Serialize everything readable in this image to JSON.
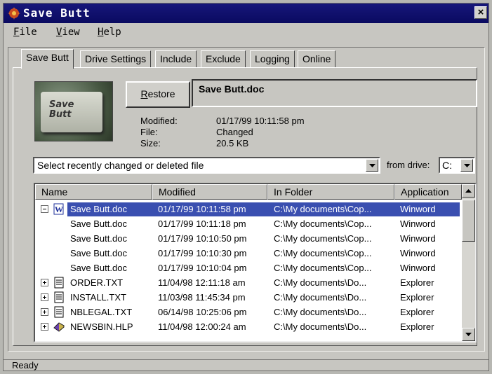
{
  "window": {
    "title": "Save Butt",
    "close_label": "×"
  },
  "menu": [
    {
      "key": "F",
      "rest": "ile"
    },
    {
      "key": "V",
      "rest": "iew"
    },
    {
      "key": "H",
      "rest": "elp"
    }
  ],
  "tabs": [
    "Save Butt",
    "Drive Settings",
    "Include",
    "Exclude",
    "Logging",
    "Online"
  ],
  "active_tab": "Save Butt",
  "logo": {
    "text": "Save\nButt"
  },
  "restore": {
    "key": "R",
    "rest": "estore"
  },
  "selected_file": {
    "name": "Save Butt.doc",
    "details": [
      {
        "label": "Modified:",
        "value": "01/17/99 10:11:58 pm"
      },
      {
        "label": "File:",
        "value": "Changed"
      },
      {
        "label": "Size:",
        "value": "20.5 KB"
      }
    ]
  },
  "file_select": {
    "value": "Select recently changed or deleted file"
  },
  "drive": {
    "label": "from drive:",
    "value": "C:"
  },
  "columns": [
    "Name",
    "Modified",
    "In Folder",
    "Application"
  ],
  "rows": [
    {
      "expander": "minus",
      "icon": "word-doc-icon",
      "name": "Save Butt.doc",
      "modified": "01/17/99 10:11:58 pm",
      "folder": "C:\\My documents\\Cop...",
      "app": "Winword",
      "selected": true
    },
    {
      "expander": "",
      "icon": "",
      "name": "Save Butt.doc",
      "modified": "01/17/99 10:11:18 pm",
      "folder": "C:\\My documents\\Cop...",
      "app": "Winword"
    },
    {
      "expander": "",
      "icon": "",
      "name": "Save Butt.doc",
      "modified": "01/17/99 10:10:50 pm",
      "folder": "C:\\My documents\\Cop...",
      "app": "Winword"
    },
    {
      "expander": "",
      "icon": "",
      "name": "Save Butt.doc",
      "modified": "01/17/99 10:10:30 pm",
      "folder": "C:\\My documents\\Cop...",
      "app": "Winword"
    },
    {
      "expander": "",
      "icon": "",
      "name": "Save Butt.doc",
      "modified": "01/17/99 10:10:04 pm",
      "folder": "C:\\My documents\\Cop...",
      "app": "Winword"
    },
    {
      "expander": "plus",
      "icon": "text-file-icon",
      "name": "ORDER.TXT",
      "modified": "11/04/98 12:11:18 am",
      "folder": "C:\\My documents\\Do...",
      "app": "Explorer"
    },
    {
      "expander": "plus",
      "icon": "text-file-icon",
      "name": "INSTALL.TXT",
      "modified": "11/03/98 11:45:34 pm",
      "folder": "C:\\My documents\\Do...",
      "app": "Explorer"
    },
    {
      "expander": "plus",
      "icon": "text-file-icon",
      "name": "NBLEGAL.TXT",
      "modified": "06/14/98 10:25:06 pm",
      "folder": "C:\\My documents\\Do...",
      "app": "Explorer"
    },
    {
      "expander": "plus",
      "icon": "help-book-icon",
      "name": "NEWSBIN.HLP",
      "modified": "11/04/98 12:00:24 am",
      "folder": "C:\\My documents\\Do...",
      "app": "Explorer"
    }
  ],
  "status": "Ready",
  "colors": {
    "title_bar": "#0a0a60",
    "selection": "#3a4fb0",
    "face": "#c7c6c1"
  }
}
